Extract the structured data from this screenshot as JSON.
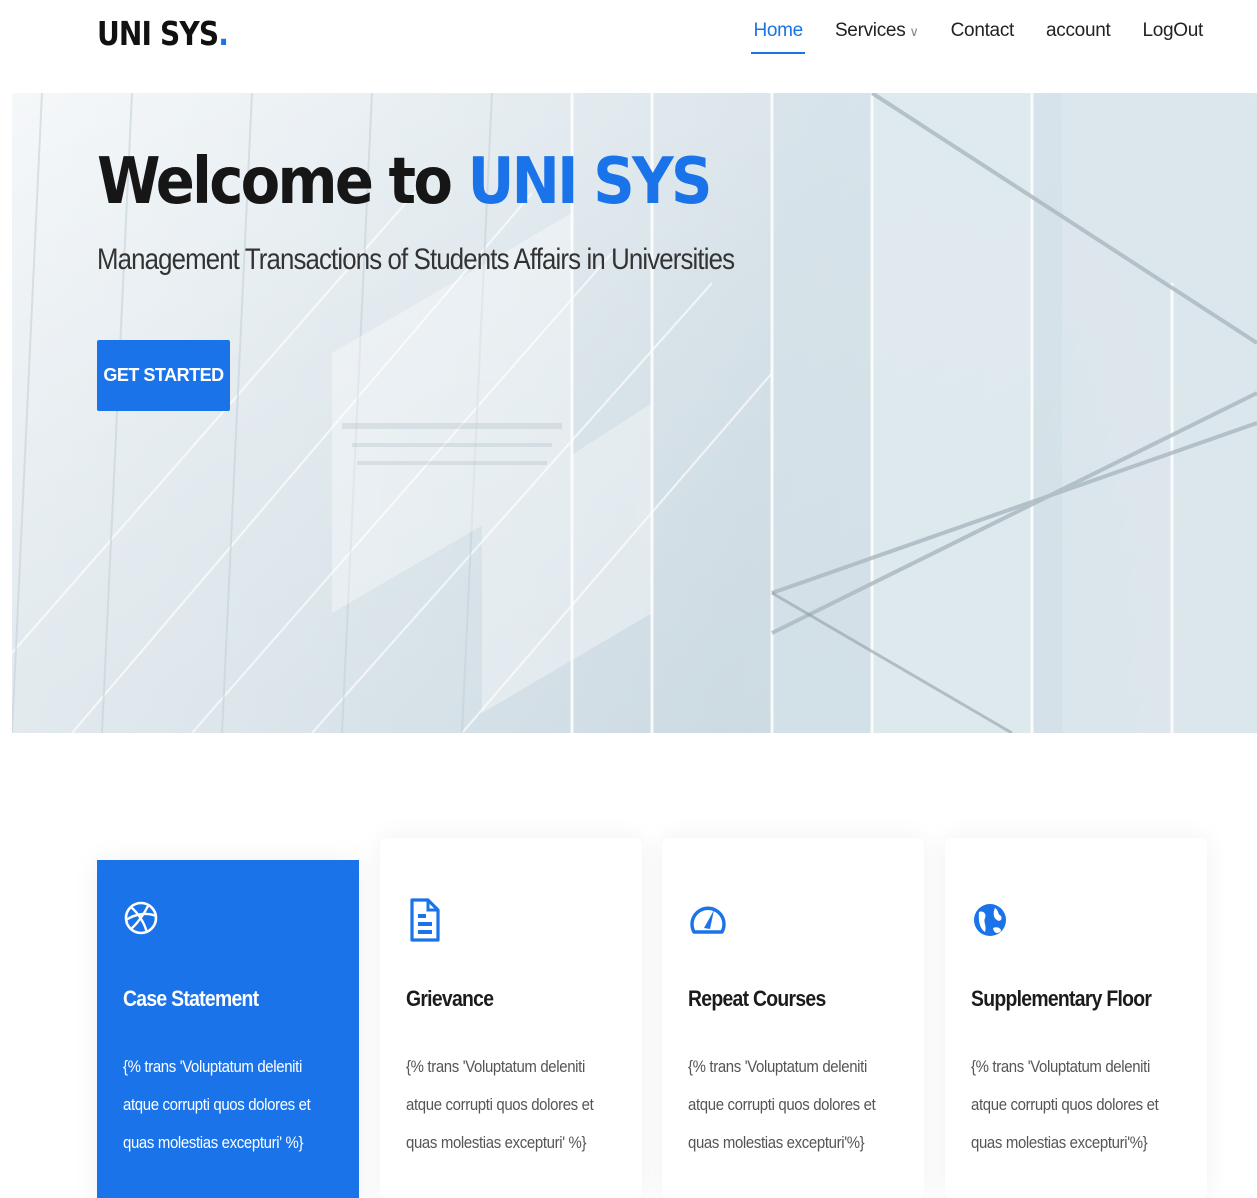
{
  "header": {
    "logo_text": "UNI SYS",
    "logo_dot": ".",
    "nav": [
      {
        "label": "Home"
      },
      {
        "label": "Services"
      },
      {
        "label": "Contact"
      },
      {
        "label": "account"
      },
      {
        "label": "LogOut"
      }
    ]
  },
  "hero": {
    "title_prefix": "Welcome to ",
    "title_accent": "UNI SYS",
    "subtitle": "Management Transactions of Students Affairs in Universities",
    "cta_label": "GET STARTED"
  },
  "cards": [
    {
      "title": "Case Statement",
      "icon": "dribbble-icon",
      "desc": "{% trans 'Voluptatum deleniti atque corrupti quos dolores et quas molestias excepturi' %}"
    },
    {
      "title": "Grievance",
      "icon": "file-text-icon",
      "desc": "{% trans 'Voluptatum deleniti atque corrupti quos dolores et quas molestias excepturi' %}"
    },
    {
      "title": "Repeat Courses",
      "icon": "speedometer-icon",
      "desc": "{% trans 'Voluptatum deleniti atque corrupti quos dolores et quas molestias excepturi'%}"
    },
    {
      "title": "Supplementary Floor",
      "icon": "globe-icon",
      "desc": "{% trans 'Voluptatum deleniti atque corrupti quos dolores et quas molestias excepturi'%}"
    }
  ],
  "colors": {
    "accent": "#1a73e8",
    "text": "#161616"
  }
}
